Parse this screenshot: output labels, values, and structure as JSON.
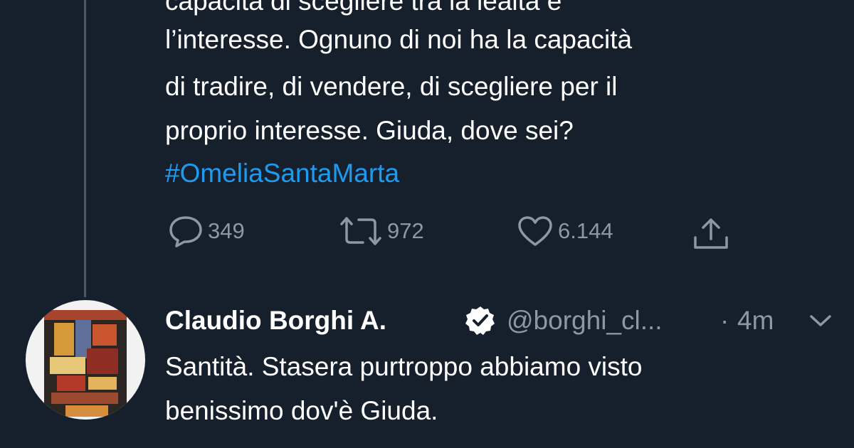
{
  "first_tweet": {
    "text_lines": [
      "capacità di scegliere tra la lealtà e",
      "l’interesse. Ognuno di noi ha la capacità",
      "di tradire, di vendere, di scegliere per il",
      "proprio interesse. Giuda, dove sei?"
    ],
    "hashtag": "#OmeliaSantaMarta",
    "actions": {
      "reply_count": "349",
      "retweet_count": "972",
      "like_count": "6.144"
    }
  },
  "reply_tweet": {
    "author_name": "Claudio Borghi A.",
    "handle": "@borghi_cl...",
    "separator": "·",
    "time": "4m",
    "text_lines": [
      "Santità. Stasera purtroppo abbiamo visto",
      "benissimo dov'è Giuda."
    ]
  },
  "colors": {
    "background": "#16202c",
    "text": "#ffffff",
    "secondary_text": "#8b98a5",
    "link": "#1d9bf0",
    "thread_line": "#4a5866"
  },
  "icons": {
    "reply": "reply-icon",
    "retweet": "retweet-icon",
    "like": "heart-icon",
    "share": "share-icon",
    "verified": "verified-badge-icon",
    "more": "chevron-down-icon"
  }
}
